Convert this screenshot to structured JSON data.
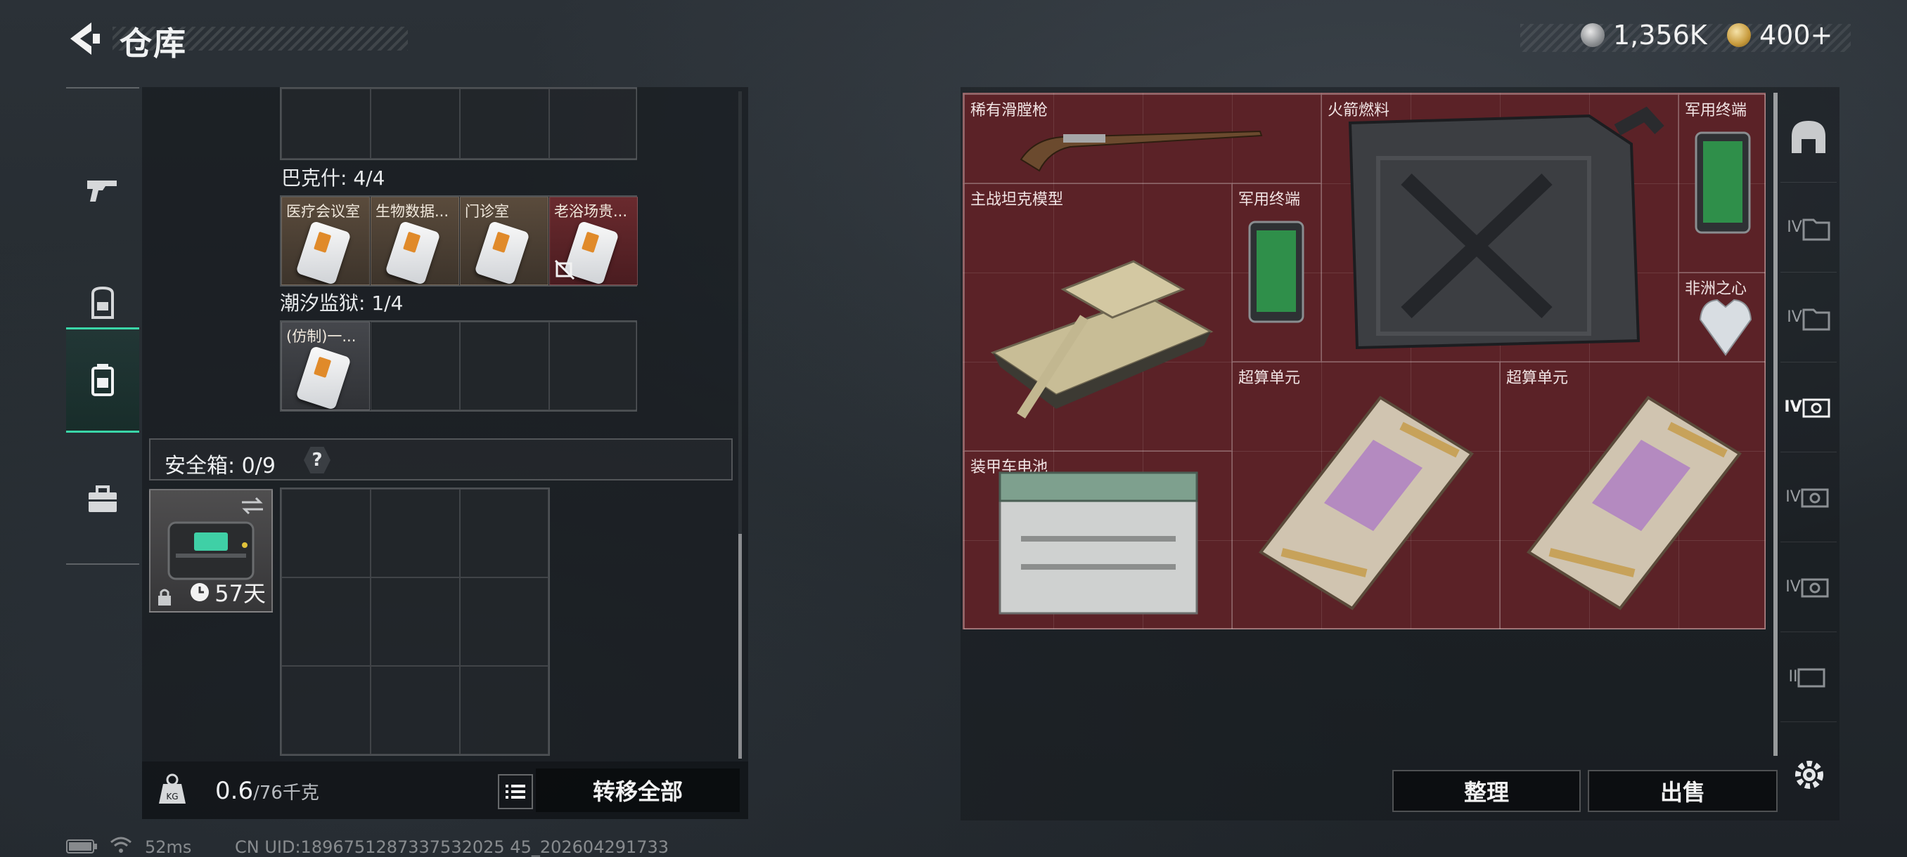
{
  "header": {
    "title": "仓库",
    "currency_silver": "1,356K",
    "currency_gold": "400+"
  },
  "left_sidebar": {
    "tabs": [
      "gun-icon",
      "backpack-icon",
      "container-icon",
      "briefcase-icon"
    ],
    "active_tab": 2
  },
  "left_panel": {
    "bakeshi_label": "巴克什: 4/4",
    "bakeshi_cards": [
      "医疗会议室",
      "生物数据...",
      "门诊室",
      "老浴场贵..."
    ],
    "chaoxi_label": "潮汐监狱: 1/4",
    "chaoxi_cards": [
      "(仿制)一..."
    ],
    "safebox_label": "安全箱: 0/9",
    "safebox_help": "?",
    "safebox_time": "57天",
    "weight_current": "0.6",
    "weight_max": "/76千克",
    "transfer_all": "转移全部"
  },
  "stash": {
    "items": [
      {
        "name": "稀有滑膛枪"
      },
      {
        "name": "火箭燃料"
      },
      {
        "name": "军用终端"
      },
      {
        "name": "主战坦克模型"
      },
      {
        "name": "军用终端"
      },
      {
        "name": "非洲之心"
      },
      {
        "name": "超算单元"
      },
      {
        "name": "超算单元"
      },
      {
        "name": "装甲车电池"
      }
    ],
    "organize": "整理",
    "sell": "出售"
  },
  "right_rail": {
    "tabs": [
      "helmet-icon",
      "IV",
      "IV",
      "IV",
      "IV",
      "IV",
      "II"
    ]
  },
  "status_bar": {
    "ping": "52ms",
    "uid": "CN UID:1896751287337532025 45_202604291733"
  },
  "colors": {
    "accent": "#3ad6a8",
    "stash_red": "#5b2227"
  }
}
